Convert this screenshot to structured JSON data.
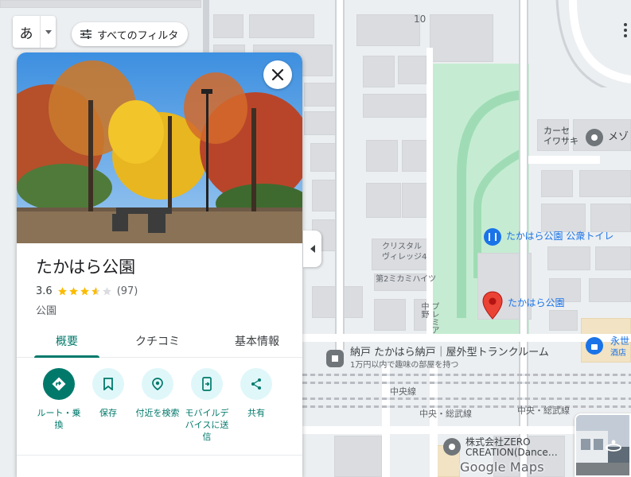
{
  "map": {
    "labels": {
      "block_number": "10",
      "car_sensor": "カーセ\nイワサキ",
      "meison": "メゾ",
      "crystal_village": "クリスタル\nヴィレッジ4",
      "mikami_heights": "第2ミカミハイツ",
      "premier": "プレミア\n中野",
      "park_name": "たかはら公園",
      "toilet": "たかはら公園 公衆トイレ",
      "trunk_room": "納戸 たかはら納戸｜屋外型トランクルーム",
      "trunk_room_sub": "1万円以内で趣味の部屋を持つ",
      "chuo_line": "中央線",
      "chuo_sobu_left": "中央・総武線",
      "chuo_sobu_right": "中央・総武線",
      "eisei": "永世",
      "eisei_sub": "酒店",
      "zero_creation": "株式会社ZERO\nCREATION(Dance…"
    },
    "colors": {
      "park": "#c5ecd2",
      "pin": "#ea4335",
      "poi_blue": "#1a73e8",
      "poi_gray": "#70757a"
    }
  },
  "controls": {
    "ime_char": "あ",
    "filter_label": "すべてのフィルタ"
  },
  "place": {
    "title": "たかはら公園",
    "rating": "3.6",
    "rating_value": 3.6,
    "reviews": "(97)",
    "category": "公園",
    "tabs": [
      {
        "label": "概要",
        "active": true
      },
      {
        "label": "クチコミ",
        "active": false
      },
      {
        "label": "基本情報",
        "active": false
      }
    ],
    "actions": [
      {
        "label": "ルート・乗\n換",
        "icon": "directions-icon"
      },
      {
        "label": "保存",
        "icon": "bookmark-icon"
      },
      {
        "label": "付近を検索",
        "icon": "nearby-icon"
      },
      {
        "label": "モバイルデ\nバイスに送\n信",
        "icon": "send-to-phone-icon"
      },
      {
        "label": "共有",
        "icon": "share-icon"
      }
    ],
    "accent": "#00796b"
  },
  "footer": {
    "logo": "Google Maps"
  }
}
